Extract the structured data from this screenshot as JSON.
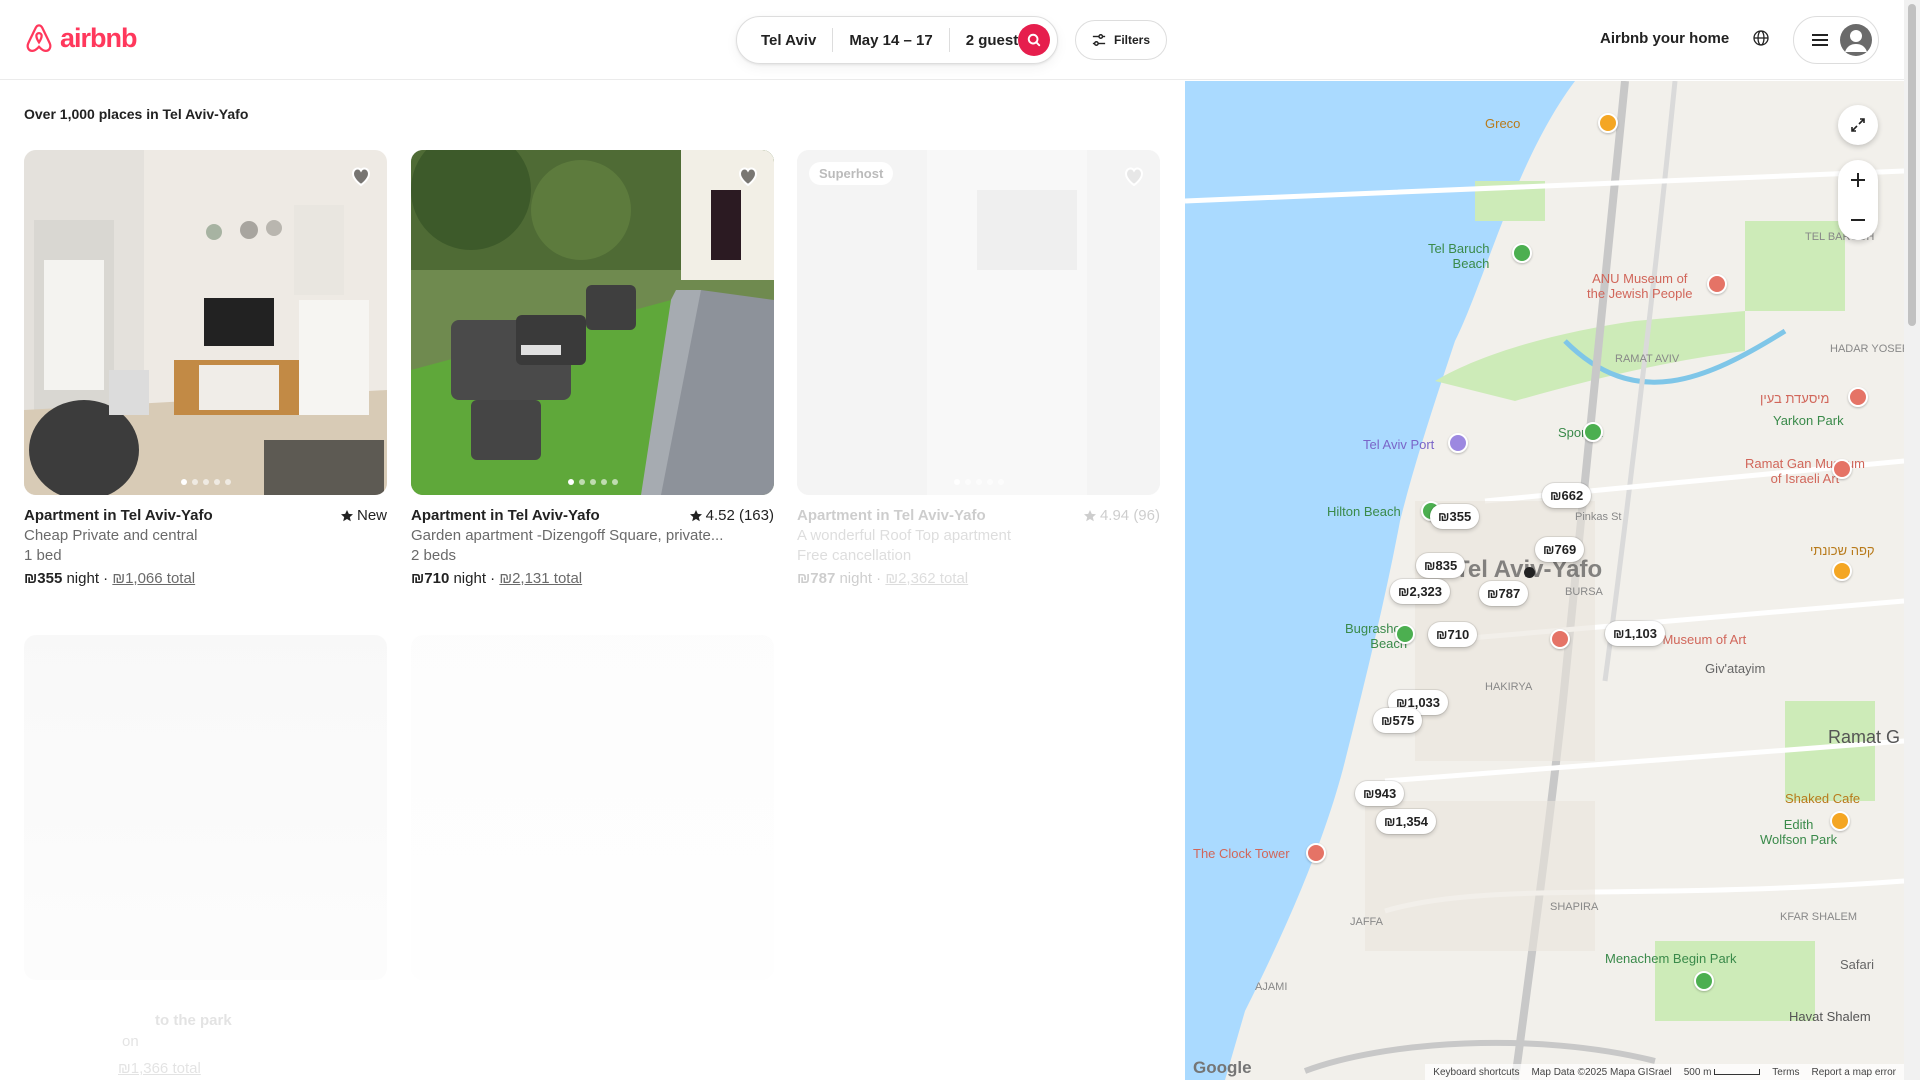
{
  "header": {
    "logo_text": "airbnb",
    "search": {
      "location": "Tel Aviv",
      "dates": "May 14 – 17",
      "guests": "2 guests"
    },
    "filters_label": "Filters",
    "host_link": "Airbnb your home",
    "brand_color": "#ff385c"
  },
  "results": {
    "count_text": "Over 1,000 places in Tel Aviv-Yafo",
    "listings": [
      {
        "title": "Apartment in Tel Aviv-Yafo",
        "rating": "New",
        "subtitle": "Cheap Private and central",
        "beds": "1 bed",
        "price": "₪355",
        "night": "night",
        "total": "₪1,066 total"
      },
      {
        "title": "Apartment in Tel Aviv-Yafo",
        "rating": "4.52 (163)",
        "subtitle": "Garden apartment -Dizengoff Square, private...",
        "beds": "2 beds",
        "price": "₪710",
        "night": "night",
        "total": "₪2,131 total"
      },
      {
        "badge": "Superhost",
        "title": "Apartment in Tel Aviv-Yafo",
        "rating": "4.94 (96)",
        "subtitle": "A wonderful Roof Top apartment",
        "beds": "Free cancellation",
        "price": "₪787",
        "night": "night",
        "total": "₪2,362 total"
      }
    ],
    "faded_row": {
      "text_a": "to the park",
      "text_b": "on",
      "total_a": "₪1,366 total"
    }
  },
  "map": {
    "pins": [
      "₪662",
      "₪355",
      "₪769",
      "₪835",
      "₪2,323",
      "₪787",
      "₪710",
      "₪1,103",
      "₪1,033",
      "₪575",
      "₪943",
      "₪1,354"
    ],
    "labels": {
      "greco": "Greco",
      "tel_baruch": "Tel Baruch\nBeach",
      "anu": "ANU Museum of\nthe Jewish People",
      "tel_baruch_area": "TEL BARUCH",
      "ramat_aviv": "RAMAT AVIV",
      "hadar_yosef": "HADAR YOSEF",
      "hebrew_1": "מיסעדת בעין",
      "yarkon": "Yarkon Park",
      "port": "Tel Aviv Port",
      "sportek": "Sportek",
      "ramat_gan_museum": "Ramat Gan Museum\nof Israeli Art",
      "hilton": "Hilton Beach",
      "pinkas": "Pinkas St",
      "city": "Tel Aviv-Yafo",
      "hebrew_2": "קפה שכונתי",
      "bursa": "BURSA",
      "bugrashov": "Bugrashov\nBeach",
      "museum_art": "Tel Aviv Museum of Art",
      "givatayim": "Giv'atayim",
      "hakirya": "HAKIRYA",
      "ramat_g": "Ramat G",
      "shaked": "Shaked Cafe",
      "edith": "Edith\nWolfson Park",
      "clock": "The Clock Tower",
      "jaffa": "JAFFA",
      "shapira": "SHAPIRA",
      "kfar_shalem": "KFAR SHALEM",
      "ajami": "AJAMI",
      "menachem": "Menachem Begin Park",
      "safari": "Safari",
      "havat": "Havat Shalem"
    },
    "footer": {
      "shortcuts": "Keyboard shortcuts",
      "data": "Map Data ©2025 Mapa GISrael",
      "scale": "500 m",
      "terms": "Terms",
      "report": "Report a map error"
    },
    "google": "Google"
  }
}
